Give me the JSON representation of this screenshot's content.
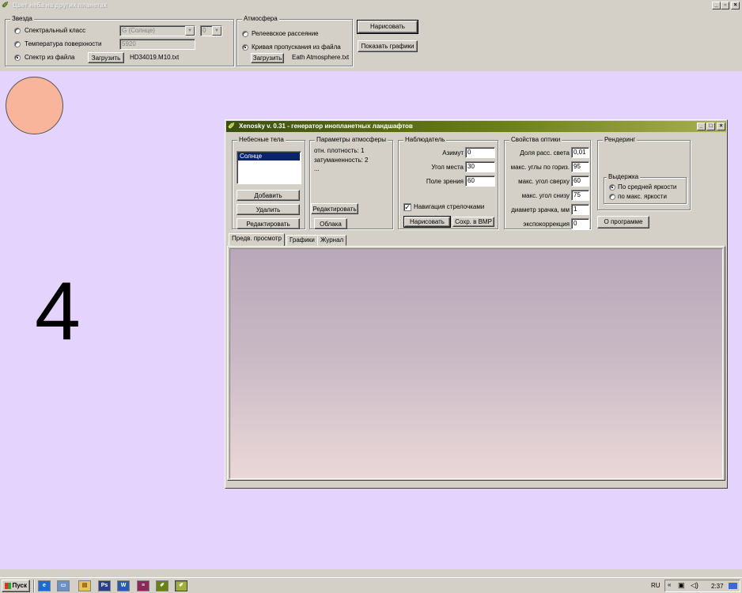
{
  "main_window": {
    "title": "Цвет неба на других планетах",
    "title_buttons": [
      "_",
      "8",
      "×"
    ]
  },
  "star_group": {
    "title": "Звезда",
    "options": [
      {
        "label": "Спектральный класс",
        "selected": false
      },
      {
        "label": "Температура поверхности",
        "selected": false
      },
      {
        "label": "Спектр из файла",
        "selected": true
      }
    ],
    "class_combo": "G (Солнце)",
    "subclass_combo": "0",
    "temperature": "5920",
    "load_button": "Загрузить",
    "file_name": "HD34019.M10.txt"
  },
  "atmosphere_group": {
    "title": "Атмосфера",
    "options": [
      {
        "label": "Релеевское рассеяние",
        "selected": false
      },
      {
        "label": "Кривая пропускания из файла",
        "selected": true
      }
    ],
    "load_button": "Загрузить",
    "file_name": "Eath Atmosphere.txt"
  },
  "draw_button": "Нарисовать",
  "show_graphs_button": "Показать графики",
  "sun_color": "#f9b49c",
  "big_number": "4",
  "xenosky": {
    "title": "Xenosky v. 0.31 - генератор инопланетных ландшафтов",
    "bodies": {
      "title": "Небесные тела",
      "items": [
        "Солнце"
      ],
      "add": "Добавить",
      "delete": "Удалить",
      "edit": "Редактировать"
    },
    "atm_params": {
      "title": "Параметры атмосферы",
      "lines": [
        "отн. плотность: 1",
        "затуманенность: 2",
        "..."
      ],
      "edit": "Редактировать",
      "clouds": "Облака"
    },
    "observer": {
      "title": "Наблюдатель",
      "fields": [
        {
          "label": "Азимут",
          "value": "0"
        },
        {
          "label": "Угол места",
          "value": "30"
        },
        {
          "label": "Поле зрения",
          "value": "60"
        }
      ],
      "arrow_nav": "Навигация стрелочками",
      "arrow_nav_checked": true,
      "draw": "Нарисовать",
      "save_bmp": "Сохр. в BMP"
    },
    "optics": {
      "title": "Свойства оптики",
      "fields": [
        {
          "label": "Доля расс. света",
          "value": "0,01"
        },
        {
          "label": "макс. углы по гориз.",
          "value": "95"
        },
        {
          "label": "макс. угол сверху",
          "value": "60"
        },
        {
          "label": "макс. угол снизу",
          "value": "75"
        },
        {
          "label": "диаметр зрачка, мм",
          "value": "1"
        },
        {
          "label": "экспокоррекция",
          "value": "0"
        }
      ]
    },
    "rendering": {
      "title": "Рендеринг",
      "exposure": {
        "title": "Выдержка",
        "options": [
          {
            "label": "По средней яркости",
            "selected": true
          },
          {
            "label": "по макс. яркости",
            "selected": false
          }
        ]
      }
    },
    "about": "О программе",
    "tabs": [
      "Предв. просмотр",
      "Графики",
      "Журнал"
    ],
    "active_tab": 0,
    "sky_top_color": "#b9a8b9",
    "sky_bottom_color": "#ead8d8"
  },
  "taskbar": {
    "start": "Пуск",
    "lang": "RU",
    "clock": "2:37"
  },
  "desktop_bg": "#e3d3fd"
}
